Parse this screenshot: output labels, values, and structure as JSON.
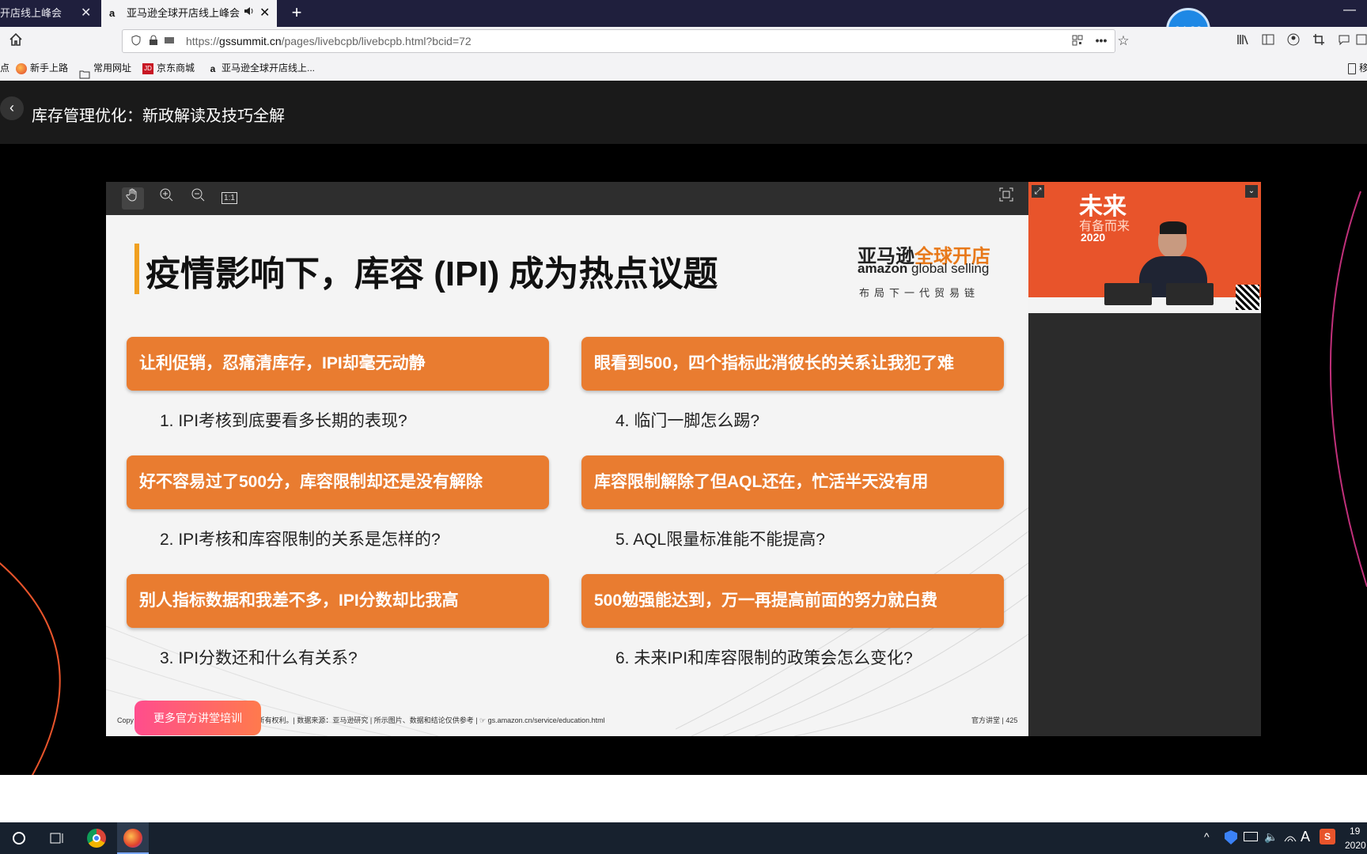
{
  "browser": {
    "tabs": [
      {
        "title": "开店线上峰会",
        "close": "✕"
      },
      {
        "title": "亚马逊全球开店线上峰会",
        "favicon": "a",
        "close": "✕"
      }
    ],
    "new_tab": "+",
    "timer": "04:33",
    "minimize": "—",
    "url": {
      "prefix": "https://",
      "host": "gssummit.cn",
      "path": "/pages/livebcpb/livebcpb.html?bcid=72"
    },
    "bookmarks": [
      {
        "label": "点"
      },
      {
        "label": "新手上路"
      },
      {
        "label": "常用网址"
      },
      {
        "label": "京东商城",
        "badge": "JD"
      },
      {
        "label": "亚马逊全球开店线上...",
        "badge": "a"
      }
    ],
    "mobile_bookmark": "移"
  },
  "page": {
    "back": "‹",
    "title": "库存管理优化：新政解读及技巧全解"
  },
  "viewer": {
    "zoom_ratio": "1:1"
  },
  "slide": {
    "title": "疫情影响下，库容 (IPI) 成为热点议题",
    "logo": {
      "cn1": "亚马逊",
      "cn2": "全球开店",
      "en1": "amazon",
      "en2": " global selling",
      "tagline": "布局下一代贸易链"
    },
    "pains": [
      "让利促销，忍痛清库存，IPI却毫无动静",
      "好不容易过了500分，库容限制却还是没有解除",
      "别人指标数据和我差不多，IPI分数却比我高",
      "眼看到500，四个指标此消彼长的关系让我犯了难",
      "库容限制解除了但AQL还在，忙活半天没有用",
      "500勉强能达到，万一再提高前面的努力就白费"
    ],
    "questions": [
      "1. IPI考核到底要看多长期的表现?",
      "2. IPI考核和库容限制的关系是怎样的?",
      "3. IPI分数还和什么有关系?",
      "4. 临门一脚怎么踢?",
      "5. AQL限量标准能不能提高?",
      "6. 未来IPI和库容限制的政策会怎么变化?"
    ],
    "footer": "Copy                                          erved. | 版权所有© 2020 亚马逊。保留所有权利。| 数据来源：亚马逊研究 | 所示图片、数据和结论仅供参考 | ☞ gs.amazon.cn/service/education.html",
    "page_label": "官方讲堂 | 425"
  },
  "more_button": "更多官方讲堂培训",
  "video": {
    "slogan1": "未来",
    "slogan2": "有备而来",
    "year": "2020"
  },
  "taskbar": {
    "clock": "19",
    "date": "2020"
  }
}
